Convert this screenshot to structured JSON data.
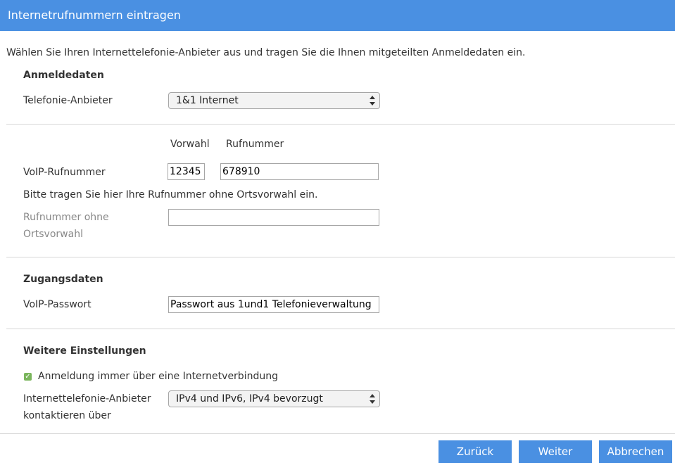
{
  "dialog": {
    "title": "Internetrufnummern eintragen"
  },
  "intro": "Wählen Sie Ihren Internettelefonie-Anbieter aus und tragen Sie die Ihnen mitgeteilten Anmeldedaten ein.",
  "anmeldedaten": {
    "heading": "Anmeldedaten",
    "provider_label": "Telefonie-Anbieter",
    "provider_value": "1&1 Internet"
  },
  "voip": {
    "col_vorwahl": "Vorwahl",
    "col_rufnummer": "Rufnummer",
    "label": "VoIP-Rufnummer",
    "vorwahl_value": "12345",
    "rufnummer_value": "678910",
    "hint": "Bitte tragen Sie hier Ihre Rufnummer ohne Ortsvorwahl ein.",
    "ohne_label_line1": "Rufnummer ohne",
    "ohne_label_line2": "Ortsvorwahl",
    "ohne_value": ""
  },
  "zugang": {
    "heading": "Zugangsdaten",
    "password_label": "VoIP-Passwort",
    "password_value": "Passwort aus 1und1 Telefonieverwaltung"
  },
  "weitere": {
    "heading": "Weitere Einstellungen",
    "checkbox_label": "Anmeldung immer über eine Internetverbindung",
    "checkbox_checked": true,
    "contact_label_line1": "Internettelefonie-Anbieter",
    "contact_label_line2": "kontaktieren über",
    "contact_value": "IPv4 und IPv6, IPv4 bevorzugt"
  },
  "buttons": {
    "back": "Zurück",
    "next": "Weiter",
    "cancel": "Abbrechen"
  },
  "colors": {
    "accent": "#4a90e2",
    "checkbox": "#7ab55c"
  }
}
